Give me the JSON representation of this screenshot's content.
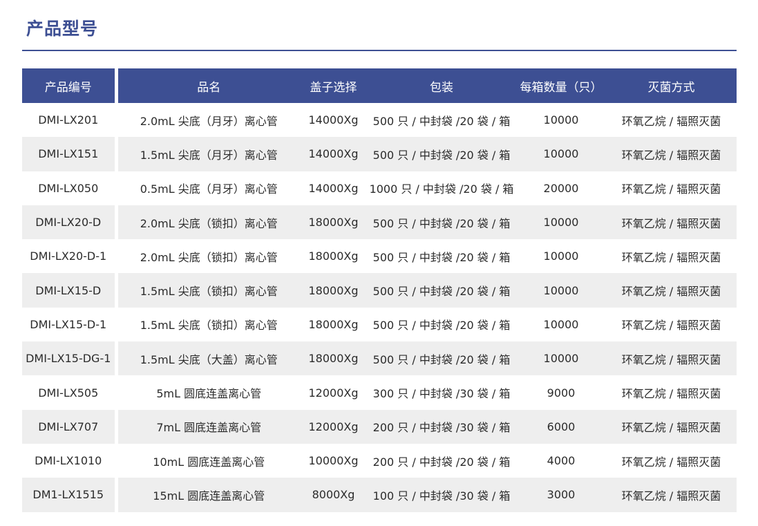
{
  "page": {
    "title": "产品型号"
  },
  "table": {
    "headers": [
      "产品编号",
      "品名",
      "盖子选择",
      "包装",
      "每箱数量（只）",
      "灭菌方式"
    ],
    "rows": [
      [
        "DMI-LX201",
        "2.0mL 尖底（月牙）离心管",
        "14000Xg",
        "500 只 / 中封袋 /20 袋 / 箱",
        "10000",
        "环氧乙烷 / 辐照灭菌"
      ],
      [
        "DMI-LX151",
        "1.5mL 尖底（月牙）离心管",
        "14000Xg",
        "500 只 / 中封袋 /20 袋 / 箱",
        "10000",
        "环氧乙烷 / 辐照灭菌"
      ],
      [
        "DMI-LX050",
        "0.5mL 尖底（月牙）离心管",
        "14000Xg",
        "1000 只 / 中封袋 /20 袋 / 箱",
        "20000",
        "环氧乙烷 / 辐照灭菌"
      ],
      [
        "DMI-LX20-D",
        "2.0mL 尖底（锁扣）离心管",
        "18000Xg",
        "500 只 / 中封袋 /20 袋 / 箱",
        "10000",
        "环氧乙烷 / 辐照灭菌"
      ],
      [
        "DMI-LX20-D-1",
        "2.0mL 尖底（锁扣）离心管",
        "18000Xg",
        "500 只 / 中封袋 /20 袋 / 箱",
        "10000",
        "环氧乙烷 / 辐照灭菌"
      ],
      [
        "DMI-LX15-D",
        "1.5mL 尖底（锁扣）离心管",
        "18000Xg",
        "500 只 / 中封袋 /20 袋 / 箱",
        "10000",
        "环氧乙烷 / 辐照灭菌"
      ],
      [
        "DMI-LX15-D-1",
        "1.5mL 尖底（锁扣）离心管",
        "18000Xg",
        "500 只 / 中封袋 /20 袋 / 箱",
        "10000",
        "环氧乙烷 / 辐照灭菌"
      ],
      [
        "DMI-LX15-DG-1",
        "1.5mL 尖底（大盖）离心管",
        "18000Xg",
        "500 只 / 中封袋 /20 袋 / 箱",
        "10000",
        "环氧乙烷 / 辐照灭菌"
      ],
      [
        "DMI-LX505",
        "5mL 圆底连盖离心管",
        "12000Xg",
        "300 只 / 中封袋 /30 袋 / 箱",
        "9000",
        "环氧乙烷 / 辐照灭菌"
      ],
      [
        "DMI-LX707",
        "7mL 圆底连盖离心管",
        "12000Xg",
        "200 只 / 中封袋 /30 袋 / 箱",
        "6000",
        "环氧乙烷 / 辐照灭菌"
      ],
      [
        "DMI-LX1010",
        "10mL 圆底连盖离心管",
        "10000Xg",
        "200 只 / 中封袋 /20 袋 / 箱",
        "4000",
        "环氧乙烷 / 辐照灭菌"
      ],
      [
        "DM1-LX1515",
        "15mL 圆底连盖离心管",
        "8000Xg",
        "100 只 / 中封袋 /30 袋 / 箱",
        "3000",
        "环氧乙烷 / 辐照灭菌"
      ]
    ]
  },
  "colors": {
    "accent": "#3d4f93",
    "stripe": "#eeeeee",
    "text": "#2b2b2b"
  }
}
